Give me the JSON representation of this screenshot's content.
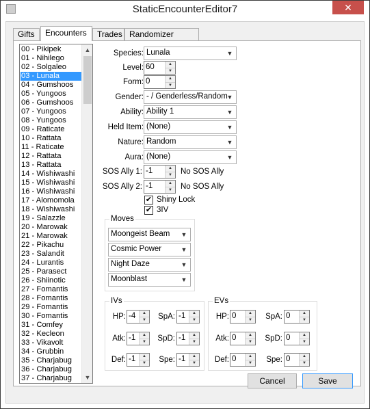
{
  "window": {
    "title": "StaticEncounterEditor7",
    "close_glyph": "✕"
  },
  "tabs": [
    "Gifts",
    "Encounters",
    "Trades",
    "Randomizer Options"
  ],
  "list": {
    "items": [
      "00 - Pikipek",
      "01 - Nihilego",
      "02 - Solgaleo",
      "03 - Lunala",
      "04 - Gumshoos",
      "05 - Yungoos",
      "06 - Gumshoos",
      "07 - Yungoos",
      "08 - Yungoos",
      "09 - Raticate",
      "10 - Rattata",
      "11 - Raticate",
      "12 - Rattata",
      "13 - Rattata",
      "14 - Wishiwashi",
      "15 - Wishiwashi",
      "16 - Wishiwashi",
      "17 - Alomomola",
      "18 - Wishiwashi",
      "19 - Salazzle",
      "20 - Marowak",
      "21 - Marowak",
      "22 - Pikachu",
      "23 - Salandit",
      "24 - Lurantis",
      "25 - Parasect",
      "26 - Shiinotic",
      "27 - Fomantis",
      "28 - Fomantis",
      "29 - Fomantis",
      "30 - Fomantis",
      "31 - Comfey",
      "32 - Kecleon",
      "33 - Vikavolt",
      "34 - Grubbin",
      "35 - Charjabug",
      "36 - Charjabug",
      "37 - Charjabug"
    ],
    "selected_index": 3,
    "scroll_up_glyph": "▲",
    "scroll_down_glyph": "▼"
  },
  "form": {
    "species": {
      "label": "Species:",
      "value": "Lunala"
    },
    "level": {
      "label": "Level:",
      "value": "60"
    },
    "form": {
      "label": "Form:",
      "value": "0"
    },
    "gender": {
      "label": "Gender:",
      "value": "- / Genderless/Random"
    },
    "ability": {
      "label": "Ability:",
      "value": "Ability 1"
    },
    "held_item": {
      "label": "Held Item:",
      "value": "(None)"
    },
    "nature": {
      "label": "Nature:",
      "value": "Random"
    },
    "aura": {
      "label": "Aura:",
      "value": "(None)"
    },
    "sos1": {
      "label": "SOS Ally 1:",
      "value": "-1",
      "desc": "No SOS Ally"
    },
    "sos2": {
      "label": "SOS Ally 2:",
      "value": "-1",
      "desc": "No SOS Ally"
    },
    "shiny_lock": {
      "label": "Shiny Lock",
      "checked": true
    },
    "three_iv": {
      "label": "3IV",
      "checked": true
    }
  },
  "moves": {
    "title": "Moves",
    "items": [
      "Moongeist Beam",
      "Cosmic Power",
      "Night Daze",
      "Moonblast"
    ]
  },
  "ivs": {
    "title": "IVs",
    "hp": {
      "label": "HP:",
      "value": "-4"
    },
    "atk": {
      "label": "Atk:",
      "value": "-1"
    },
    "def": {
      "label": "Def:",
      "value": "-1"
    },
    "spa": {
      "label": "SpA:",
      "value": "-1"
    },
    "spd": {
      "label": "SpD:",
      "value": "-1"
    },
    "spe": {
      "label": "Spe:",
      "value": "-1"
    }
  },
  "evs": {
    "title": "EVs",
    "hp": {
      "label": "HP:",
      "value": "0"
    },
    "atk": {
      "label": "Atk:",
      "value": "0"
    },
    "def": {
      "label": "Def:",
      "value": "0"
    },
    "spa": {
      "label": "SpA:",
      "value": "0"
    },
    "spd": {
      "label": "SpD:",
      "value": "0"
    },
    "spe": {
      "label": "Spe:",
      "value": "0"
    }
  },
  "buttons": {
    "cancel": "Cancel",
    "save": "Save"
  },
  "glyphs": {
    "combo_arrow": "▼",
    "spin_up": "▲",
    "spin_down": "▼",
    "check": "✔"
  },
  "colors": {
    "selection": "#3399ff",
    "close_button": "#c7504b"
  }
}
